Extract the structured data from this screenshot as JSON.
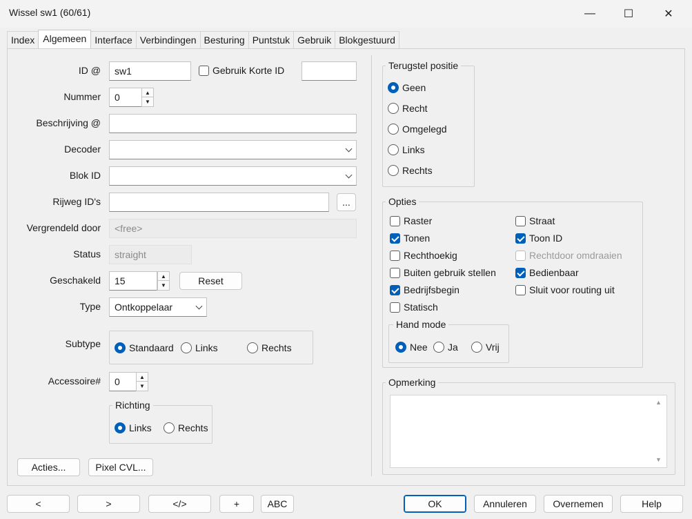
{
  "window": {
    "title": "Wissel sw1 (60/61)",
    "minimize": "—",
    "maximize": "☐",
    "close": "✕"
  },
  "tabs": [
    "Index",
    "Algemeen",
    "Interface",
    "Verbindingen",
    "Besturing",
    "Puntstuk",
    "Gebruik",
    "Blokgestuurd"
  ],
  "form": {
    "id_label": "ID @",
    "id_value": "sw1",
    "short_id_label": "Gebruik Korte ID",
    "short_id_checked": false,
    "short_id_value": "",
    "nummer_label": "Nummer",
    "nummer_value": "0",
    "beschrijving_label": "Beschrijving @",
    "beschrijving_value": "",
    "decoder_label": "Decoder",
    "decoder_value": "",
    "blok_label": "Blok ID",
    "blok_value": "",
    "rijweg_label": "Rijweg ID's",
    "rijweg_value": "",
    "rijweg_button": "...",
    "vergrendeld_label": "Vergrendeld door",
    "vergrendeld_value": "<free>",
    "status_label": "Status",
    "status_value": "straight",
    "geschakeld_label": "Geschakeld",
    "geschakeld_value": "15",
    "reset_button": "Reset",
    "type_label": "Type",
    "type_value": "Ontkoppelaar",
    "subtype_label": "Subtype",
    "subtype_options": [
      {
        "label": "Standaard",
        "checked": true
      },
      {
        "label": "Links",
        "checked": false
      },
      {
        "label": "Rechts",
        "checked": false
      }
    ],
    "accessoire_label": "Accessoire#",
    "accessoire_value": "0",
    "richting_title": "Richting",
    "richting_options": [
      {
        "label": "Links",
        "checked": true
      },
      {
        "label": "Rechts",
        "checked": false
      }
    ],
    "acties_button": "Acties...",
    "pixel_button": "Pixel CVL..."
  },
  "terugstel": {
    "title": "Terugstel positie",
    "options": [
      {
        "label": "Geen",
        "checked": true
      },
      {
        "label": "Recht",
        "checked": false
      },
      {
        "label": "Omgelegd",
        "checked": false
      },
      {
        "label": "Links",
        "checked": false
      },
      {
        "label": "Rechts",
        "checked": false
      }
    ]
  },
  "opties": {
    "title": "Opties",
    "left": [
      {
        "label": "Raster",
        "checked": false
      },
      {
        "label": "Tonen",
        "checked": true
      },
      {
        "label": "Rechthoekig",
        "checked": false
      },
      {
        "label": "Buiten gebruik stellen",
        "checked": false
      },
      {
        "label": "Bedrijfsbegin",
        "checked": true
      },
      {
        "label": "Statisch",
        "checked": false
      }
    ],
    "right": [
      {
        "label": "Straat",
        "checked": false
      },
      {
        "label": "Toon ID",
        "checked": true
      },
      {
        "label": "Rechtdoor omdraaien",
        "checked": false,
        "disabled": true
      },
      {
        "label": "Bedienbaar",
        "checked": true
      },
      {
        "label": "Sluit voor routing uit",
        "checked": false
      }
    ],
    "hand_mode": {
      "title": "Hand mode",
      "options": [
        {
          "label": "Nee",
          "checked": true
        },
        {
          "label": "Ja",
          "checked": false
        },
        {
          "label": "Vrij",
          "checked": false
        }
      ]
    }
  },
  "opmerking": {
    "title": "Opmerking",
    "value": ""
  },
  "bottom": {
    "prev": "<",
    "next": ">",
    "code": "</>",
    "add": "+",
    "abc": "ABC",
    "ok": "OK",
    "annuleren": "Annuleren",
    "overnemen": "Overnemen",
    "help": "Help"
  }
}
